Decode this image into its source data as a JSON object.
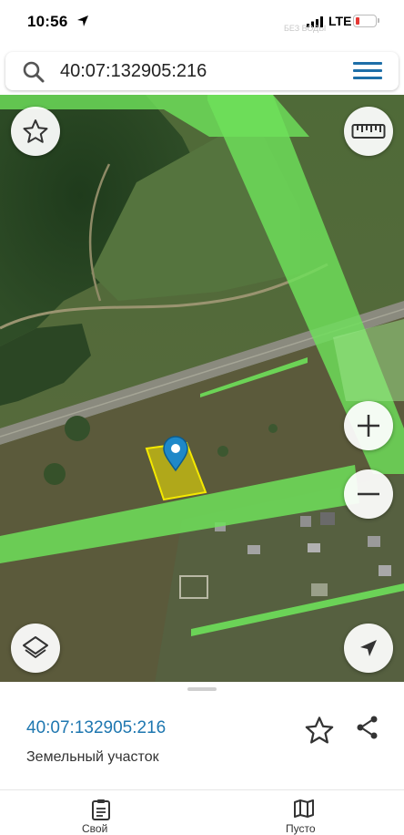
{
  "status_bar": {
    "time": "10:56",
    "network": "LTE",
    "watermark": "БЕЗ ВОДЫ"
  },
  "search": {
    "value": "40:07:132905:216",
    "icon": "search-icon",
    "menu_icon": "hamburger-menu-icon"
  },
  "map": {
    "type": "satellite",
    "zone_color": "#6ee05a",
    "parcel_color": "#f5e900",
    "marker_color": "#1e88c8",
    "controls": [
      "star-icon",
      "ruler-icon",
      "zoom-in-icon",
      "zoom-out-icon",
      "layers-icon",
      "locate-icon"
    ]
  },
  "sheet": {
    "cadastral_number": "40:07:132905:216",
    "object_type": "Земельный участок",
    "accent": "#1e77b0"
  },
  "tabs": [
    {
      "label": "Свой",
      "icon": "clipboard-icon"
    },
    {
      "label": "Пусто",
      "icon": "map-icon"
    }
  ]
}
